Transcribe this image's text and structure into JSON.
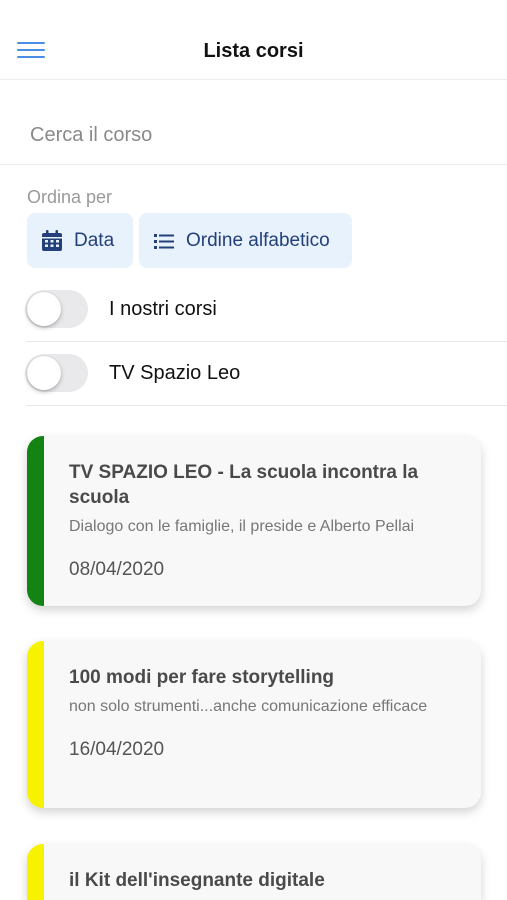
{
  "navbar": {
    "title": "Lista corsi",
    "menu_icon": "hamburger-menu-icon"
  },
  "search": {
    "placeholder": "Cerca il corso",
    "value": ""
  },
  "sort": {
    "label": "Ordina per",
    "options": [
      {
        "label": "Data",
        "icon": "calendar-icon"
      },
      {
        "label": "Ordine alfabetico",
        "icon": "list-icon"
      }
    ]
  },
  "filters": [
    {
      "label": "I nostri corsi",
      "on": false
    },
    {
      "label": "TV Spazio Leo",
      "on": false
    }
  ],
  "courses": [
    {
      "title": "TV SPAZIO LEO - La scuola incontra la scuola",
      "subtitle": "Dialogo con le famiglie, il preside e Alberto Pellai",
      "date": "08/04/2020",
      "color": "#138413"
    },
    {
      "title": "100 modi per fare storytelling",
      "subtitle": "non solo strumenti...anche comunicazione efficace",
      "date": "16/04/2020",
      "color": "#f7f300"
    },
    {
      "title": "il Kit dell'insegnante digitale",
      "subtitle": "",
      "date": "",
      "color": "#f7f300"
    }
  ],
  "colors": {
    "accent": "#4a8fe6",
    "chip_bg": "#e8f2fc",
    "chip_text": "#24407a"
  }
}
